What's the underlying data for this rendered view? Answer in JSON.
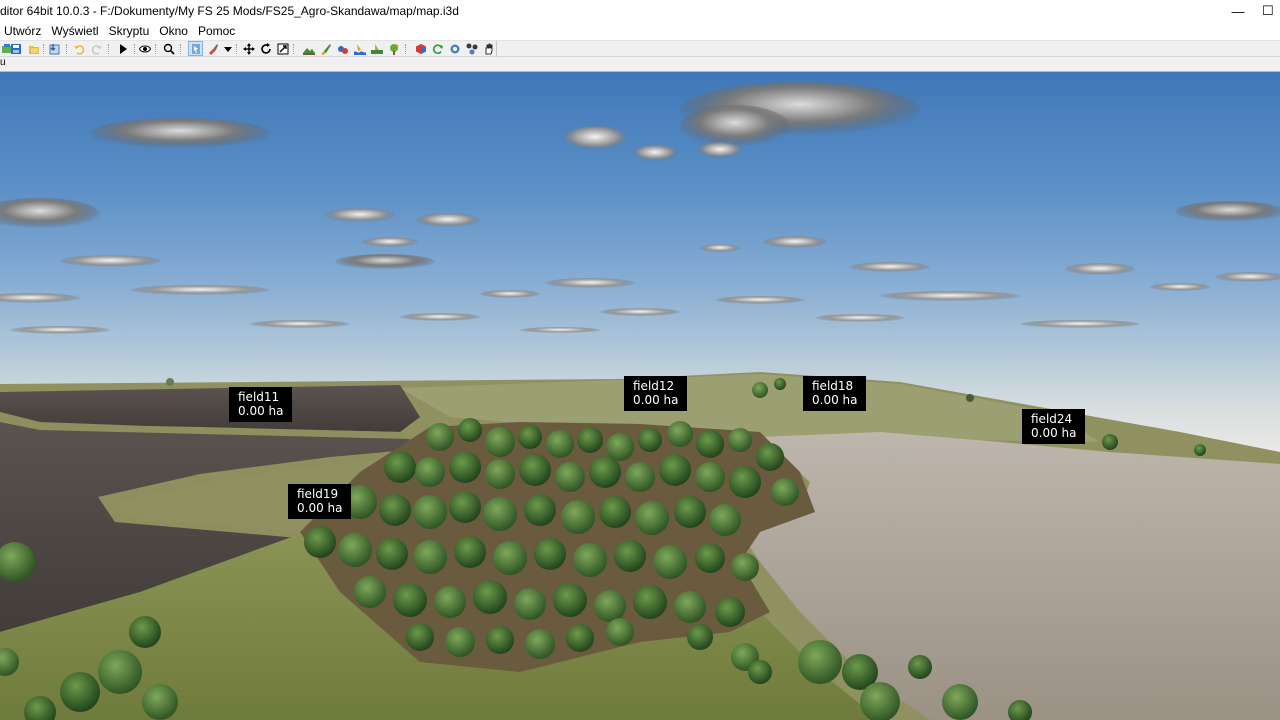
{
  "window": {
    "title": "ditor 64bit 10.0.3 - F:/Dokumenty/My FS 25 Mods/FS25_Agro-Skandawa/map/map.i3d",
    "minimize_glyph": "—",
    "maximize_glyph": "☐"
  },
  "menu": {
    "items": [
      {
        "label": "Utwórz"
      },
      {
        "label": "Wyświetl"
      },
      {
        "label": "Skryptu"
      },
      {
        "label": "Okno"
      },
      {
        "label": "Pomoc"
      }
    ]
  },
  "toolbar": {
    "icons": [
      "new-file-icon",
      "save-icon",
      "open-icon",
      "import-icon",
      "undo-icon",
      "redo-icon",
      "play-icon",
      "eye-icon",
      "zoom-icon",
      "select-icon",
      "brush-icon",
      "dropdown-icon",
      "move-icon",
      "rotate-icon",
      "scale-icon",
      "terrain-icon",
      "paint-icon",
      "foliage-icon",
      "water-icon",
      "decal-icon",
      "tree-icon",
      "cube-icon",
      "refresh-icon",
      "gear-icon",
      "network-icon",
      "hand-icon"
    ]
  },
  "tabstrip": {
    "label": "u"
  },
  "viewport": {
    "fields": [
      {
        "name": "field11",
        "area": "0.00 ha"
      },
      {
        "name": "field12",
        "area": "0.00 ha"
      },
      {
        "name": "field18",
        "area": "0.00 ha"
      },
      {
        "name": "field24",
        "area": "0.00 ha"
      },
      {
        "name": "field19",
        "area": "0.00 ha"
      }
    ]
  },
  "colors": {
    "sky_top": "#3f77b8",
    "horizon": "#e9e8e4",
    "field_dark": "#4a4441",
    "grass": "#7e8a4a",
    "plowed_light": "#a39b90",
    "forest": "#3e6a2e",
    "label_bg": "#000000",
    "label_text": "#ffffff"
  }
}
